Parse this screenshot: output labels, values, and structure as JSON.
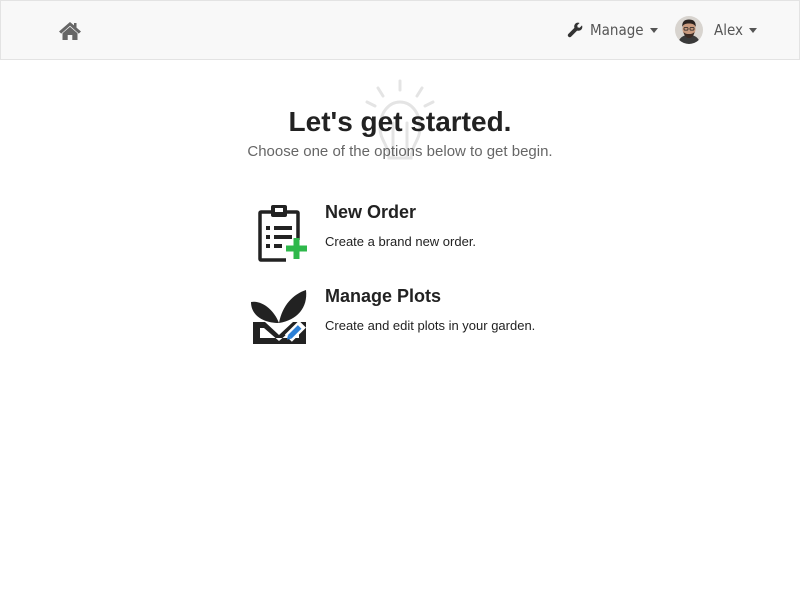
{
  "navbar": {
    "home_icon": "home-icon",
    "manage_label": "Manage",
    "manage_icon": "wrench-icon",
    "user_name": "Alex"
  },
  "main": {
    "title": "Let's get started.",
    "subtitle": "Choose one of the options below to get begin.",
    "options": [
      {
        "title": "New Order",
        "description": "Create a brand new order.",
        "icon": "clipboard-add-icon",
        "accent": "#2eb84b"
      },
      {
        "title": "Manage Plots",
        "description": "Create and edit plots in your garden.",
        "icon": "plant-edit-icon",
        "accent": "#2b7fd6"
      }
    ]
  }
}
